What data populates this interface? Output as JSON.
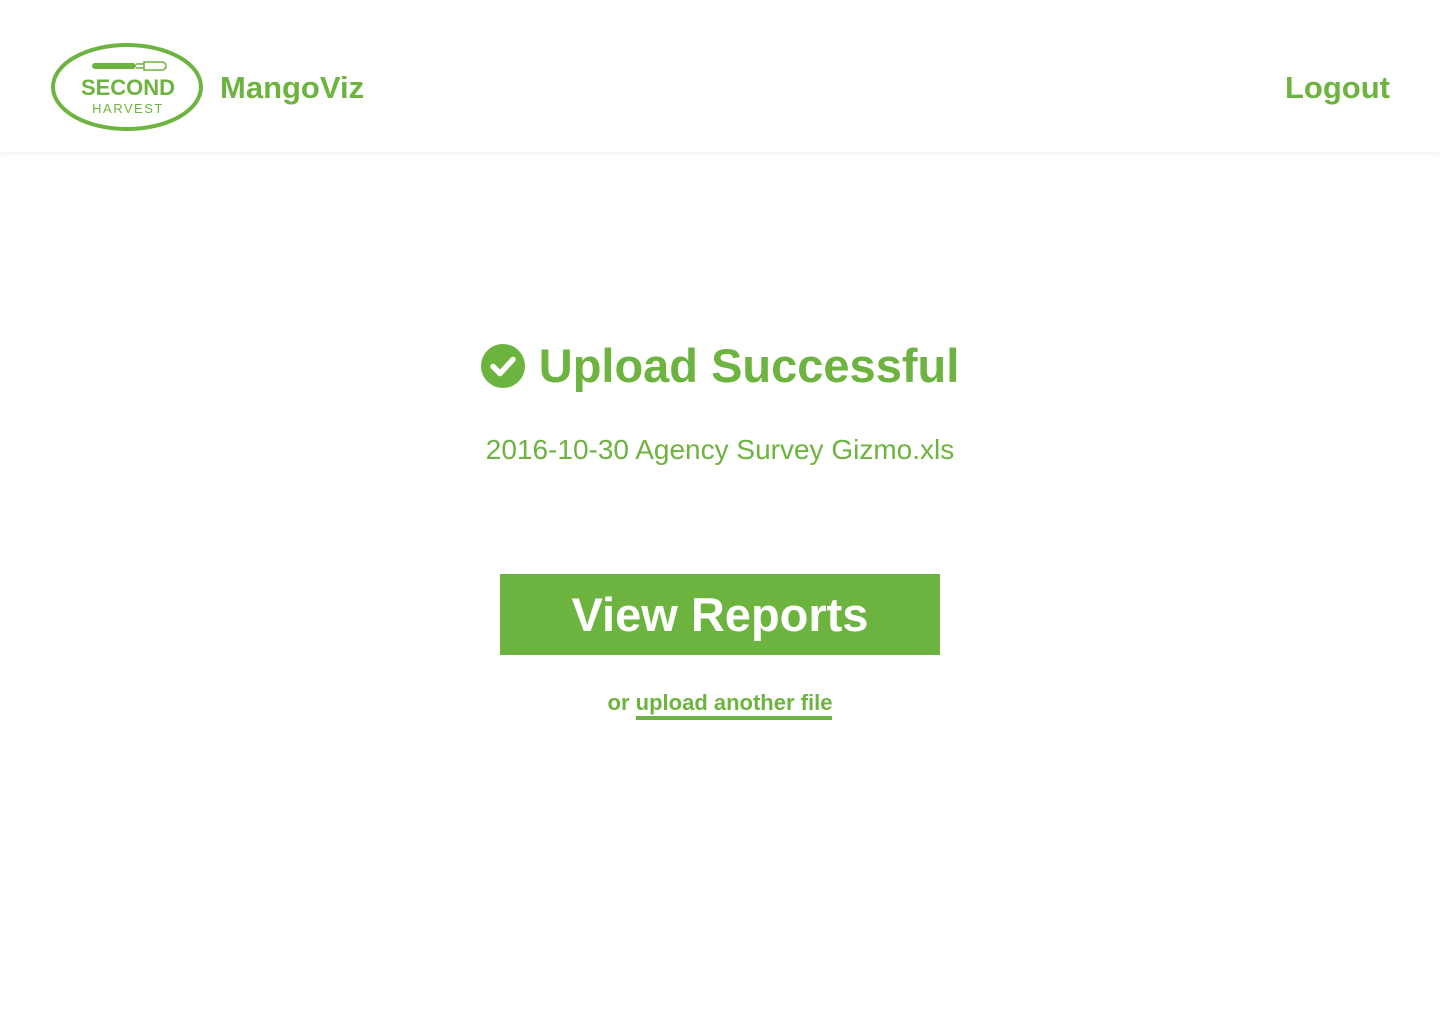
{
  "header": {
    "logo": {
      "line1": "SECOND",
      "line2": "HARVEST",
      "icon": "fork-icon"
    },
    "app_name": "MangoViz",
    "logout_label": "Logout"
  },
  "status": {
    "icon": "check-circle-icon",
    "title": "Upload Successful",
    "filename": "2016-10-30 Agency Survey Gizmo.xls"
  },
  "actions": {
    "view_reports_label": "View Reports",
    "or_text": "or",
    "upload_another_label": "upload another file"
  },
  "colors": {
    "brand_green": "#6db33f",
    "background": "#ffffff",
    "button_text": "#ffffff"
  }
}
